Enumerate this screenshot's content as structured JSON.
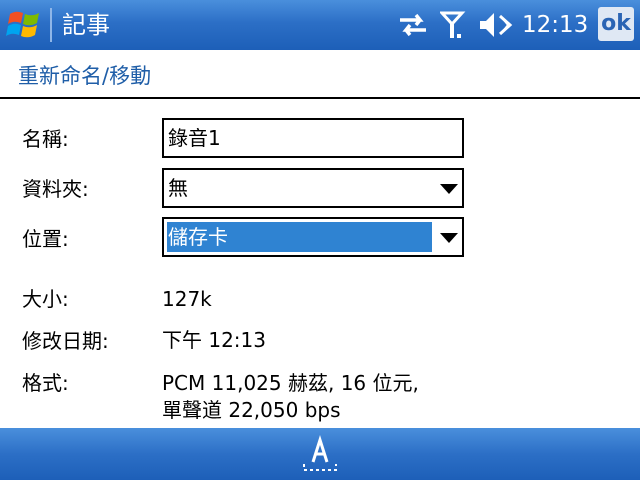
{
  "titlebar": {
    "app_title": "記事",
    "clock": "12:13",
    "ok_label": "ok"
  },
  "page": {
    "title": "重新命名/移動"
  },
  "form": {
    "name_label": "名稱:",
    "name_value": "錄音1",
    "folder_label": "資料夾:",
    "folder_value": "無",
    "location_label": "位置:",
    "location_value": "儲存卡"
  },
  "info": {
    "size_label": "大小:",
    "size_value": "127k",
    "modified_label": "修改日期:",
    "modified_value": "下午 12:13",
    "format_label": "格式:",
    "format_line1": "PCM 11,025 赫茲, 16 位元,",
    "format_line2": "單聲道 22,050 bps"
  },
  "bottombar": {
    "input_icon": "keyboard-input-icon"
  },
  "colors": {
    "titlebar": "#2c6fc6",
    "page_title": "#1f5ea8",
    "selection": "#2f83d2"
  }
}
